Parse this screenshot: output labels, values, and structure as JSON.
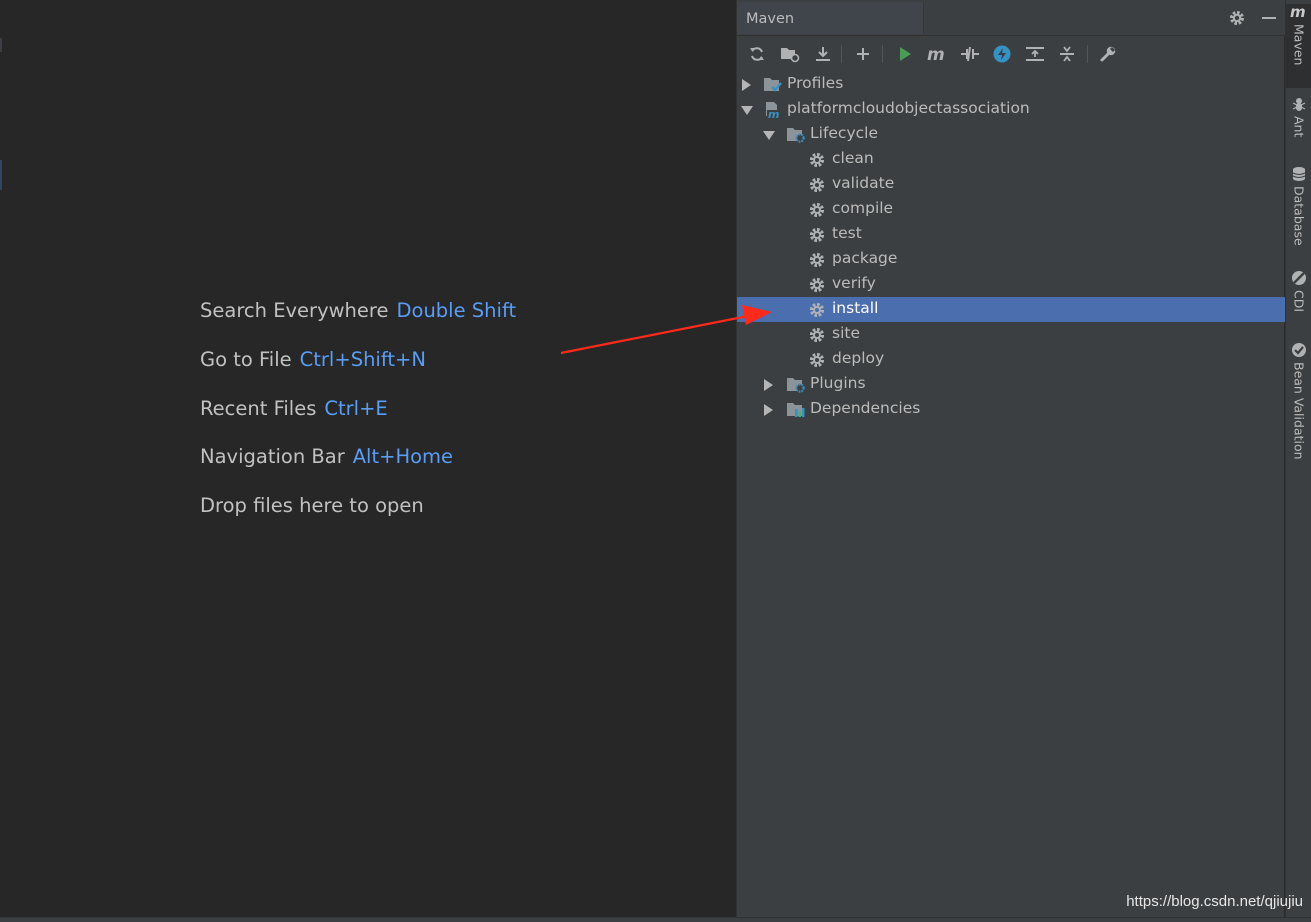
{
  "editor": {
    "hints": [
      {
        "label": "Search Everywhere",
        "key": "Double Shift"
      },
      {
        "label": "Go to File",
        "key": "Ctrl+Shift+N"
      },
      {
        "label": "Recent Files",
        "key": "Ctrl+E"
      },
      {
        "label": "Navigation Bar",
        "key": "Alt+Home"
      },
      {
        "label": "Drop files here to open",
        "key": ""
      }
    ]
  },
  "maven": {
    "title": "Maven",
    "toolbar": [
      "reload-icon",
      "generate-sources-icon",
      "download-icon",
      "add-icon",
      "run-icon",
      "execute-goal-icon",
      "toggle-offline-icon",
      "skip-tests-icon",
      "show-dependencies-icon",
      "collapse-all-icon",
      "settings-wrench-icon"
    ],
    "tree": {
      "profiles": "Profiles",
      "project": "platformcloudobjectassociation",
      "lifecycle": "Lifecycle",
      "goals": [
        "clean",
        "validate",
        "compile",
        "test",
        "package",
        "verify",
        "install",
        "site",
        "deploy"
      ],
      "selected_goal": "install",
      "plugins": "Plugins",
      "dependencies": "Dependencies"
    }
  },
  "stripe": {
    "tabs": [
      {
        "label": "Maven",
        "active": true
      },
      {
        "label": "Ant",
        "active": false
      },
      {
        "label": "Database",
        "active": false
      },
      {
        "label": "CDI",
        "active": false
      },
      {
        "label": "Bean Validation",
        "active": false
      }
    ]
  },
  "watermark": "https://blog.csdn.net/qjiujiu",
  "colors": {
    "accent": "#589df6",
    "selection": "#4b6eaf",
    "annotation_arrow": "#ff2a1a",
    "run_green": "#59a869"
  }
}
